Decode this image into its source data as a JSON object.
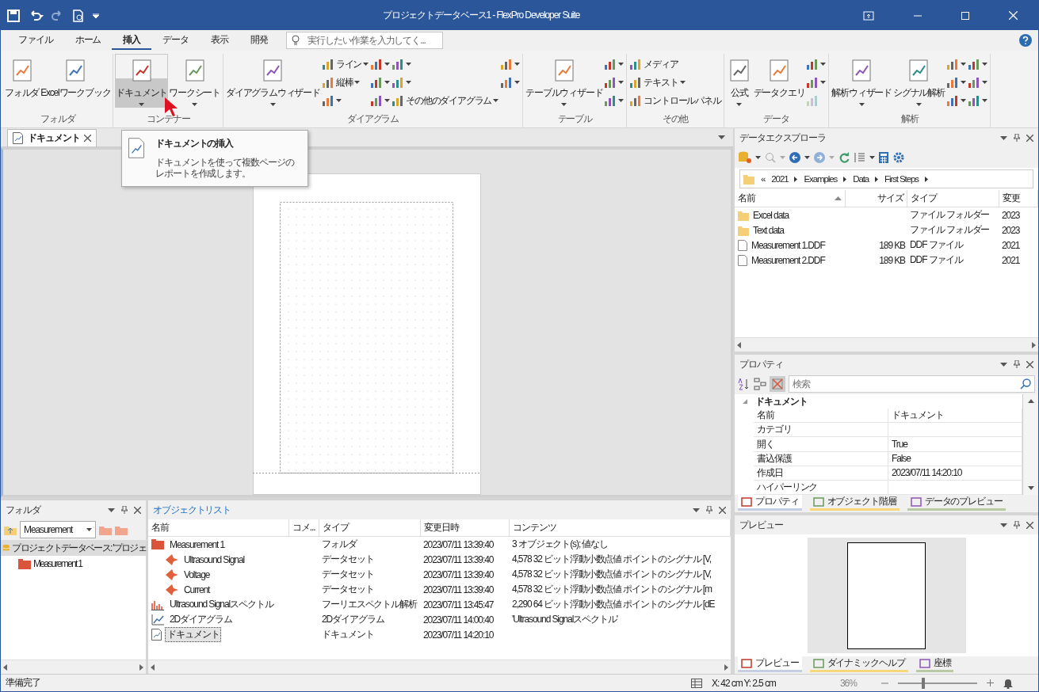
{
  "title_bar": {
    "title": "プロジェクトデータベース1 - FlexPro Developer Suite"
  },
  "menu_tabs": [
    {
      "label": "ファイル",
      "selected": false
    },
    {
      "label": "ホーム",
      "selected": false
    },
    {
      "label": "挿入",
      "selected": true
    },
    {
      "label": "データ",
      "selected": false
    },
    {
      "label": "表示",
      "selected": false
    },
    {
      "label": "開発",
      "selected": false
    }
  ],
  "search": {
    "placeholder": "実行したい作業を入力してく..."
  },
  "ribbon": {
    "groups": [
      {
        "label": "フォルダ",
        "items": [
          {
            "kind": "large",
            "label": "フォルダ",
            "dropdown": false,
            "pressed": false
          },
          {
            "kind": "large",
            "label": "Excelワークブック",
            "dropdown": false,
            "pressed": false
          }
        ]
      },
      {
        "label": "コンテナー",
        "items": [
          {
            "kind": "large",
            "label": "ドキュメント",
            "dropdown": true,
            "pressed": true
          },
          {
            "kind": "large",
            "label": "ワークシート",
            "dropdown": true,
            "pressed": false
          }
        ]
      },
      {
        "label": "ダイアグラム",
        "items": [
          {
            "kind": "large",
            "label": "ダイアグラムウィザード",
            "dropdown": true,
            "pressed": false
          },
          {
            "kind": "stack",
            "buttons": [
              {
                "label": "ライン",
                "dropdown": true
              },
              {
                "label": "縦棒",
                "dropdown": true
              },
              {
                "dropdown": true
              }
            ]
          },
          {
            "kind": "stack",
            "buttons": [
              {
                "dropdown": true
              },
              {
                "dropdown": true
              },
              {
                "dropdown": true
              }
            ]
          },
          {
            "kind": "stack",
            "buttons": [
              {
                "dropdown": true
              },
              {
                "dropdown": true
              },
              {
                "label": "その他のダイアグラム",
                "dropdown": true
              }
            ]
          },
          {
            "kind": "stack",
            "buttons": [
              {
                "dropdown": true
              },
              {
                "dropdown": true
              }
            ]
          }
        ]
      },
      {
        "label": "テーブル",
        "items": [
          {
            "kind": "large",
            "label": "テーブルウィザード",
            "dropdown": true,
            "pressed": false
          },
          {
            "kind": "stack",
            "buttons": [
              {
                "dropdown": true
              },
              {
                "dropdown": true
              },
              {
                "dropdown": true
              }
            ]
          }
        ]
      },
      {
        "label": "その他",
        "items": [
          {
            "kind": "stack",
            "buttons": [
              {
                "label": "メディア",
                "dropdown": false
              },
              {
                "label": "テキスト",
                "dropdown": true
              },
              {
                "label": "コントロールパネル",
                "dropdown": false
              }
            ]
          }
        ]
      },
      {
        "label": "データ",
        "items": [
          {
            "kind": "large",
            "label": "公式",
            "dropdown": true,
            "pressed": false
          },
          {
            "kind": "large",
            "label": "データクエリ",
            "dropdown": false,
            "pressed": false
          },
          {
            "kind": "stack",
            "buttons": [
              {
                "dropdown": true,
                "disabled": false
              },
              {
                "dropdown": true,
                "disabled": false
              },
              {
                "dropdown": false,
                "disabled": true
              }
            ]
          }
        ]
      },
      {
        "label": "解析",
        "items": [
          {
            "kind": "large",
            "label": "解析ウィザード",
            "dropdown": true,
            "pressed": false
          },
          {
            "kind": "large",
            "label": "シグナル解析",
            "dropdown": true,
            "pressed": false
          },
          {
            "kind": "stack",
            "buttons": [
              {
                "dropdown": true
              },
              {
                "dropdown": true
              },
              {
                "dropdown": true
              }
            ]
          },
          {
            "kind": "stack",
            "buttons": [
              {
                "dropdown": true
              },
              {
                "dropdown": true
              },
              {
                "dropdown": true
              }
            ]
          }
        ]
      }
    ]
  },
  "document": {
    "tab": {
      "label": "ドキュメント"
    },
    "tooltip": {
      "title": "ドキュメントの挿入",
      "text": "ドキュメントを使って複数ページのレポートを作成します。"
    }
  },
  "folder_pane": {
    "title": "フォルダ",
    "active": false,
    "combo_value": "Measurement",
    "tree": [
      {
        "label": "プロジェクトデータベース: 'プロジェ",
        "selected": true,
        "children": [
          {
            "label": "Measurement 1",
            "selected": false
          }
        ]
      }
    ]
  },
  "object_list": {
    "title": "オブジェクトリスト",
    "active": true,
    "columns": [
      "名前",
      "コメ...",
      "タイプ",
      "変更日時",
      "コンテンツ"
    ],
    "rows": [
      {
        "kind": "folder",
        "name": "Measurement 1",
        "type": "フォルダ",
        "modified": "2023/07/11 13:39:40",
        "contents": "3 オブジェクト(s); 値なし",
        "selected": false,
        "children": [
          {
            "kind": "dataset",
            "name": "Ultrasound Signal",
            "type": "データセット",
            "modified": "2023/07/11 13:39:40",
            "contents": "4,578 32 ビット浮動小数点値 ポイントのシグナル [V,",
            "selected": false
          },
          {
            "kind": "dataset",
            "name": "Voltage",
            "type": "データセット",
            "modified": "2023/07/11 13:39:40",
            "contents": "4,578 32 ビット浮動小数点値 ポイントのシグナル [V,",
            "selected": false
          },
          {
            "kind": "dataset",
            "name": "Current",
            "type": "データセット",
            "modified": "2023/07/11 13:39:40",
            "contents": "4,578 32 ビット浮動小数点値 ポイントのシグナル [m",
            "selected": false
          }
        ]
      },
      {
        "kind": "spectrum",
        "name": "Ultrasound Signalスペクトル",
        "type": "フーリエスペクトル解析",
        "modified": "2023/07/11 13:45:47",
        "contents": "2,290 64 ビット浮動小数点値 ポイントのシグナル [dE",
        "selected": false
      },
      {
        "kind": "diagram",
        "name": "2Dダイアグラム",
        "type": "2Dダイアグラム",
        "modified": "2023/07/11 14:00:40",
        "contents": "'Ultrasound Signalスペクトル'",
        "selected": false
      },
      {
        "kind": "document",
        "name": "ドキュメント",
        "type": "ドキュメント",
        "modified": "2023/07/11 14:20:10",
        "selected": true
      }
    ]
  },
  "data_explorer": {
    "title": "データエクスプローラ",
    "active": false,
    "breadcrumb": {
      "prefix": "«",
      "parts": [
        "2021",
        "Examples",
        "Data",
        "First Steps"
      ]
    },
    "columns": [
      "名前",
      "サイズ",
      "タイプ",
      "変更"
    ],
    "rows": [
      {
        "kind": "folder",
        "name": "Excel data",
        "type": "ファイル フォルダー",
        "modified": "2023"
      },
      {
        "kind": "folder",
        "name": "Text data",
        "type": "ファイル フォルダー",
        "modified": "2023"
      },
      {
        "kind": "file",
        "name": "Measurement 1.DDF",
        "size": "189 KB",
        "type": "DDF ファイル",
        "modified": "2021"
      },
      {
        "kind": "file",
        "name": "Measurement 2.DDF",
        "size": "189 KB",
        "type": "DDF ファイル",
        "modified": "2021"
      }
    ]
  },
  "properties": {
    "title": "プロパティ",
    "active": false,
    "search_placeholder": "検索",
    "category": "ドキュメント",
    "rows": [
      {
        "name": "名前",
        "value": "ドキュメント"
      },
      {
        "name": "カテゴリ"
      },
      {
        "name": "開く",
        "value": "True"
      },
      {
        "name": "書込保護",
        "value": "False"
      },
      {
        "name": "作成日",
        "value": "2023/07/11 14:20:10"
      },
      {
        "name": "ハイパーリンク"
      }
    ],
    "tabs": [
      {
        "label": "プロパティ",
        "selected": true,
        "color": "#c5cfe3"
      },
      {
        "label": "オブジェクト階層",
        "selected": false,
        "color": "#f7d77a"
      },
      {
        "label": "データのプレビュー",
        "selected": false,
        "color": "#b8c9a4"
      }
    ]
  },
  "preview": {
    "title": "プレビュー",
    "active": false,
    "tabs": [
      {
        "label": "プレビュー",
        "selected": true,
        "color": "#c5cfe3"
      },
      {
        "label": "ダイナミックヘルプ",
        "selected": false,
        "color": "#f7d77a"
      },
      {
        "label": "座標",
        "selected": false,
        "color": "#b8c9a4"
      }
    ]
  },
  "status_bar": {
    "text": "準備完了",
    "coordinates": "X: 42 cm Y: 2.5 cm",
    "zoom": {
      "reading": "36%",
      "level": 0.3
    }
  }
}
